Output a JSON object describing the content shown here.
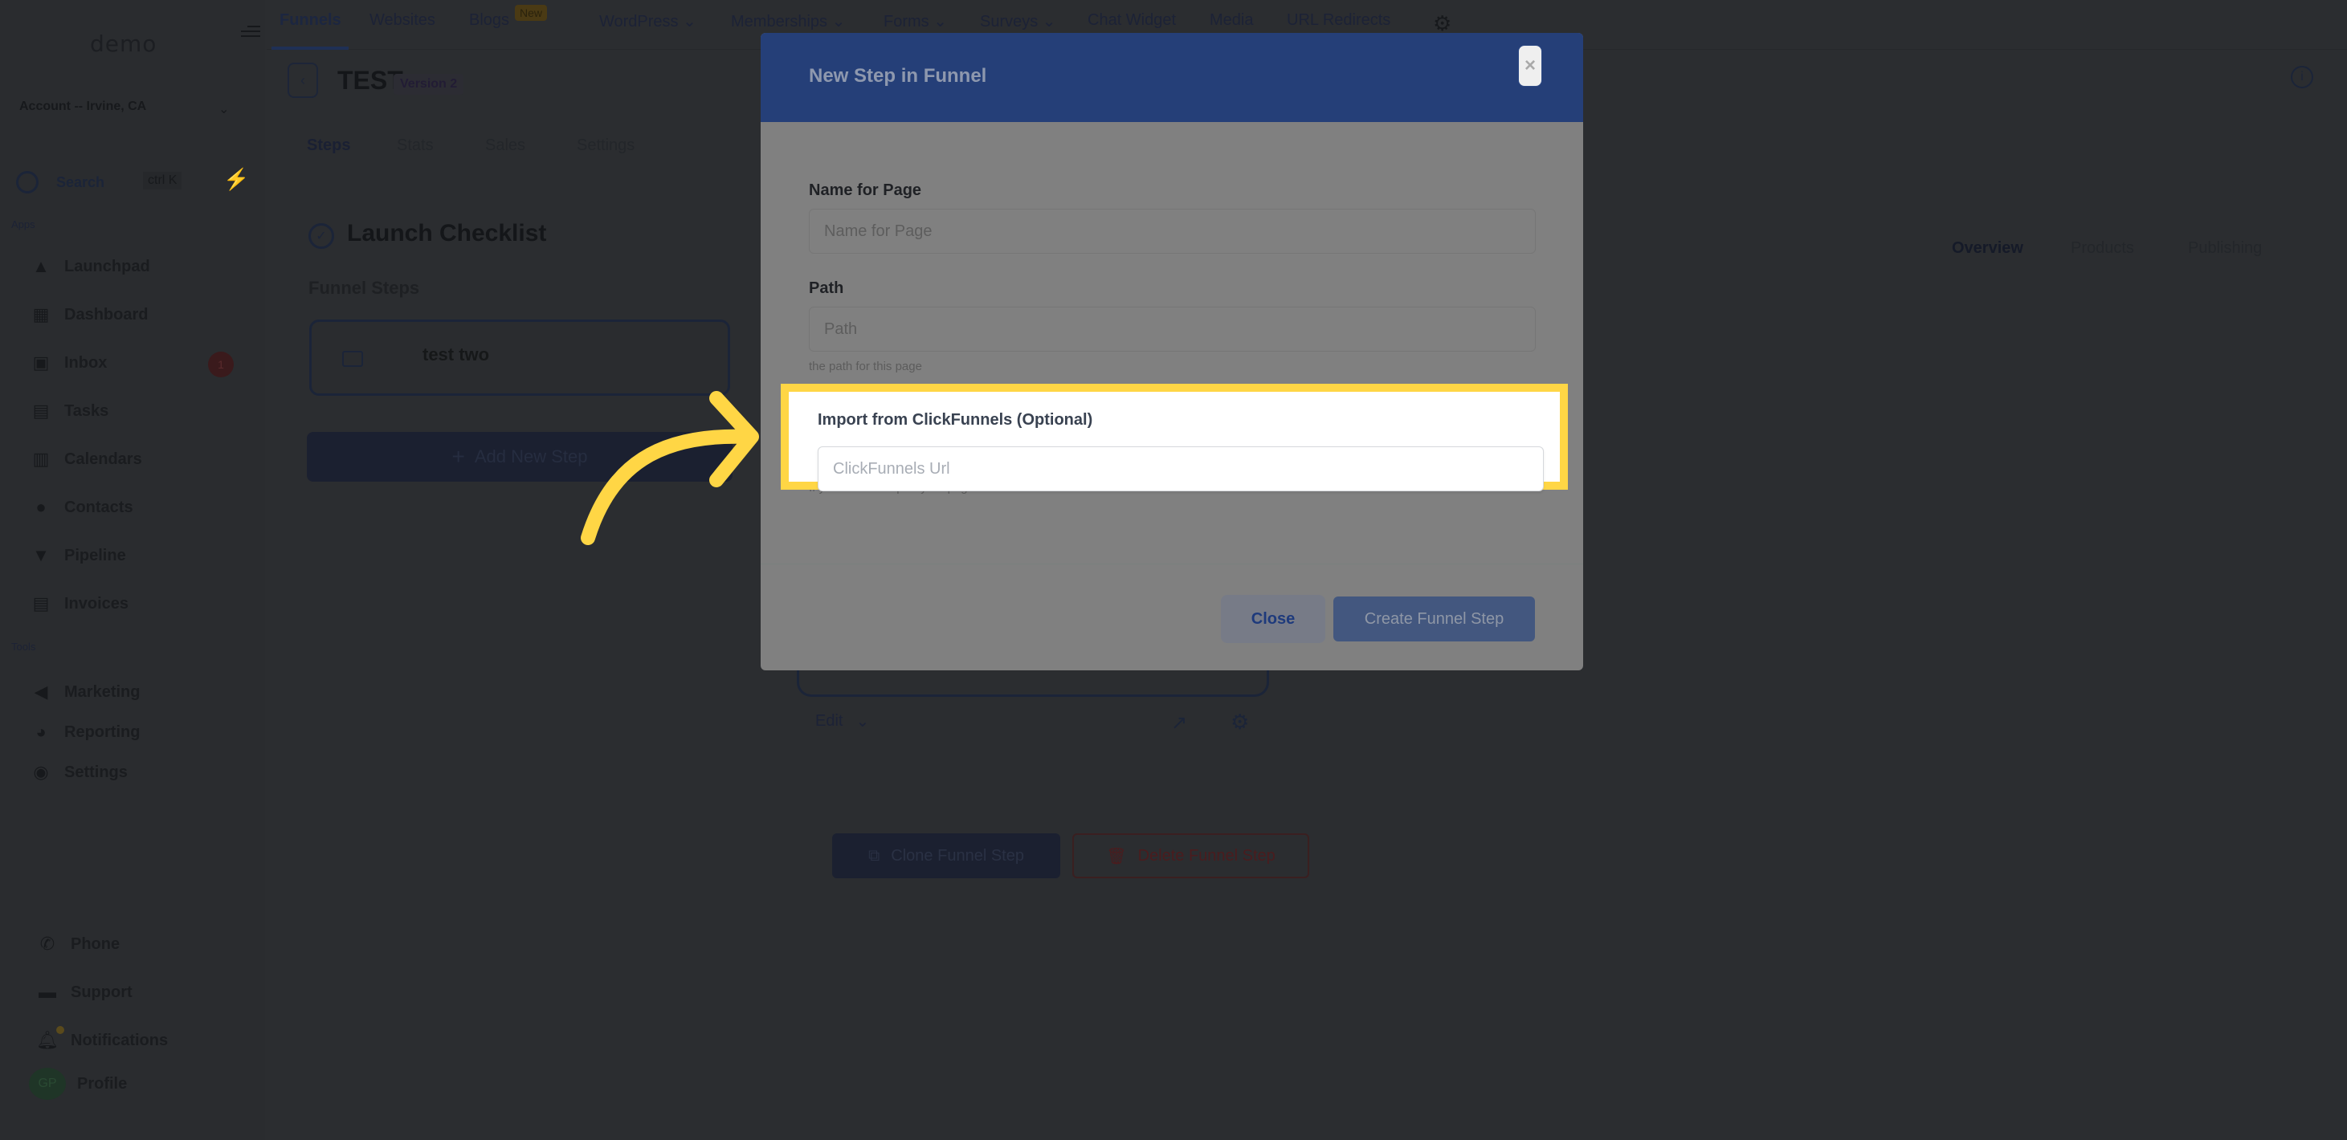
{
  "sidebar": {
    "logo": "demo",
    "account": "Account -- Irvine, CA",
    "search_label": "Search",
    "search_shortcut": "ctrl K",
    "apps_label": "Apps",
    "apps": [
      {
        "label": "Launchpad",
        "icon": "rocket-icon"
      },
      {
        "label": "Dashboard",
        "icon": "grid-icon"
      },
      {
        "label": "Inbox",
        "icon": "inbox-icon",
        "badge": "1"
      },
      {
        "label": "Tasks",
        "icon": "clipboard-check-icon"
      },
      {
        "label": "Calendars",
        "icon": "calendar-icon"
      },
      {
        "label": "Contacts",
        "icon": "user-icon"
      },
      {
        "label": "Pipeline",
        "icon": "funnel-icon"
      },
      {
        "label": "Invoices",
        "icon": "receipt-icon"
      }
    ],
    "tools_label": "Tools",
    "tools": [
      {
        "label": "Marketing",
        "icon": "megaphone-icon"
      },
      {
        "label": "Reporting",
        "icon": "pie-chart-icon"
      },
      {
        "label": "Settings",
        "icon": "gear-icon"
      }
    ],
    "bottom": [
      {
        "label": "Phone",
        "icon": "phone-icon"
      },
      {
        "label": "Support",
        "icon": "chat-icon"
      },
      {
        "label": "Notifications",
        "icon": "bell-icon"
      },
      {
        "label": "Profile",
        "icon": "avatar",
        "initials": "GP"
      }
    ]
  },
  "topnav": {
    "tabs": [
      "Funnels",
      "Websites",
      "Blogs",
      "WordPress",
      "Memberships",
      "Forms",
      "Surveys",
      "Chat Widget",
      "Media",
      "URL Redirects"
    ],
    "active_tab": "Funnels",
    "new_badge": "New"
  },
  "page": {
    "back_icon": "chevron-left-icon",
    "title": "TEST",
    "version": "Version 2",
    "subtabs": [
      "Steps",
      "Stats",
      "Sales",
      "Settings"
    ],
    "active_subtab": "Steps",
    "checklist_title": "Launch Checklist",
    "funnel_steps_label": "Funnel Steps",
    "steps": [
      {
        "name": "test two",
        "icon": "mail-icon"
      }
    ],
    "add_step_label": "Add New Step",
    "right_tabs": [
      "Overview",
      "Products",
      "Publishing"
    ],
    "active_right_tab": "Overview",
    "edit_label": "Edit",
    "clone_label": "Clone Funnel Step",
    "delete_label": "Delete Funnel Step"
  },
  "modal": {
    "title": "New Step in Funnel",
    "close_icon": "×",
    "fields": {
      "name": {
        "label": "Name for Page",
        "placeholder": "Name for Page",
        "value": ""
      },
      "path": {
        "label": "Path",
        "placeholder": "Path",
        "value": "",
        "help": "the path for this page"
      },
      "import": {
        "label": "Import from ClickFunnels (Optional)",
        "placeholder": "ClickFunnels Url",
        "value": "",
        "help": "If you want to import your page data from ClickFunnels."
      }
    },
    "close_button": "Close",
    "create_button": "Create Funnel Step"
  },
  "colors": {
    "highlight": "#ffd645",
    "modal_header": "#253f78",
    "overlay": "#2b2d30"
  }
}
